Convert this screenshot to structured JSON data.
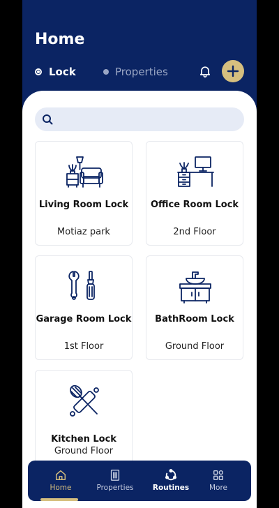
{
  "header": {
    "title": "Home",
    "tabs": [
      {
        "label": "Lock",
        "selected": true
      },
      {
        "label": "Properties",
        "selected": false
      }
    ]
  },
  "search": {
    "placeholder": ""
  },
  "cards": [
    {
      "name": "Living Room Lock",
      "location": "Motiaz park",
      "icon": "living-room-icon"
    },
    {
      "name": "Office Room Lock",
      "location": "2nd Floor",
      "icon": "office-desk-icon"
    },
    {
      "name": "Garage Room Lock",
      "location": "1st Floor",
      "icon": "tools-icon"
    },
    {
      "name": "BathRoom Lock",
      "location": "Ground Floor",
      "icon": "bathroom-sink-icon"
    },
    {
      "name": "Kitchen Lock",
      "location": "Ground Floor",
      "icon": "kitchen-utensils-icon"
    }
  ],
  "nav": [
    {
      "label": "Home",
      "icon": "home-icon",
      "active": true
    },
    {
      "label": "Properties",
      "icon": "building-icon",
      "active": false
    },
    {
      "label": "Routines",
      "icon": "routines-icon",
      "active": false
    },
    {
      "label": "More",
      "icon": "grid-icon",
      "active": false
    }
  ],
  "colors": {
    "primary": "#0b2463",
    "accent": "#d6bf7f",
    "search_bg": "#e6ebf6"
  }
}
